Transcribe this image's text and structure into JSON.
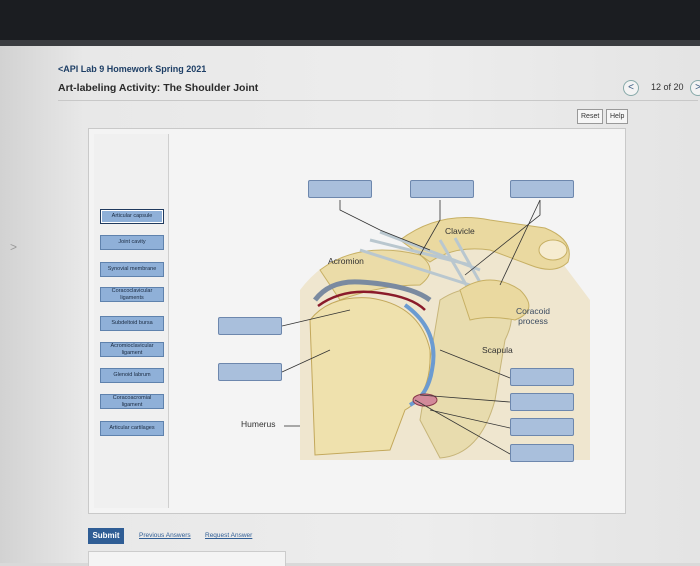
{
  "header": {
    "breadcrumb": "<API Lab 9 Homework Spring 2021",
    "title": "Art-labeling Activity: The Shoulder Joint",
    "prev_symbol": "<",
    "counter": "12 of 20",
    "next_symbol": ">"
  },
  "side_chevron": ">",
  "toolbar": {
    "reset_label": "Reset",
    "help_label": "Help"
  },
  "label_bank": [
    "Articular capsule",
    "Joint cavity",
    "Synovial membrane",
    "Coracoclavicular ligaments",
    "Subdeltoid bursa",
    "Acromioclavicular ligament",
    "Glenoid labrum",
    "Coracoacromial ligament",
    "Articular cartilages"
  ],
  "diagram": {
    "clavicle": "Clavicle",
    "acromion": "Acromion",
    "coracoid": "Coracoid process",
    "scapula": "Scapula",
    "humerus": "Humerus"
  },
  "footer": {
    "submit_label": "Submit",
    "previous_answers": "Previous Answers",
    "request_answer": "Request Answer"
  },
  "colors": {
    "chip": "#8fb0d8",
    "drop": "#a9bfdc",
    "submit": "#2f5d95"
  }
}
